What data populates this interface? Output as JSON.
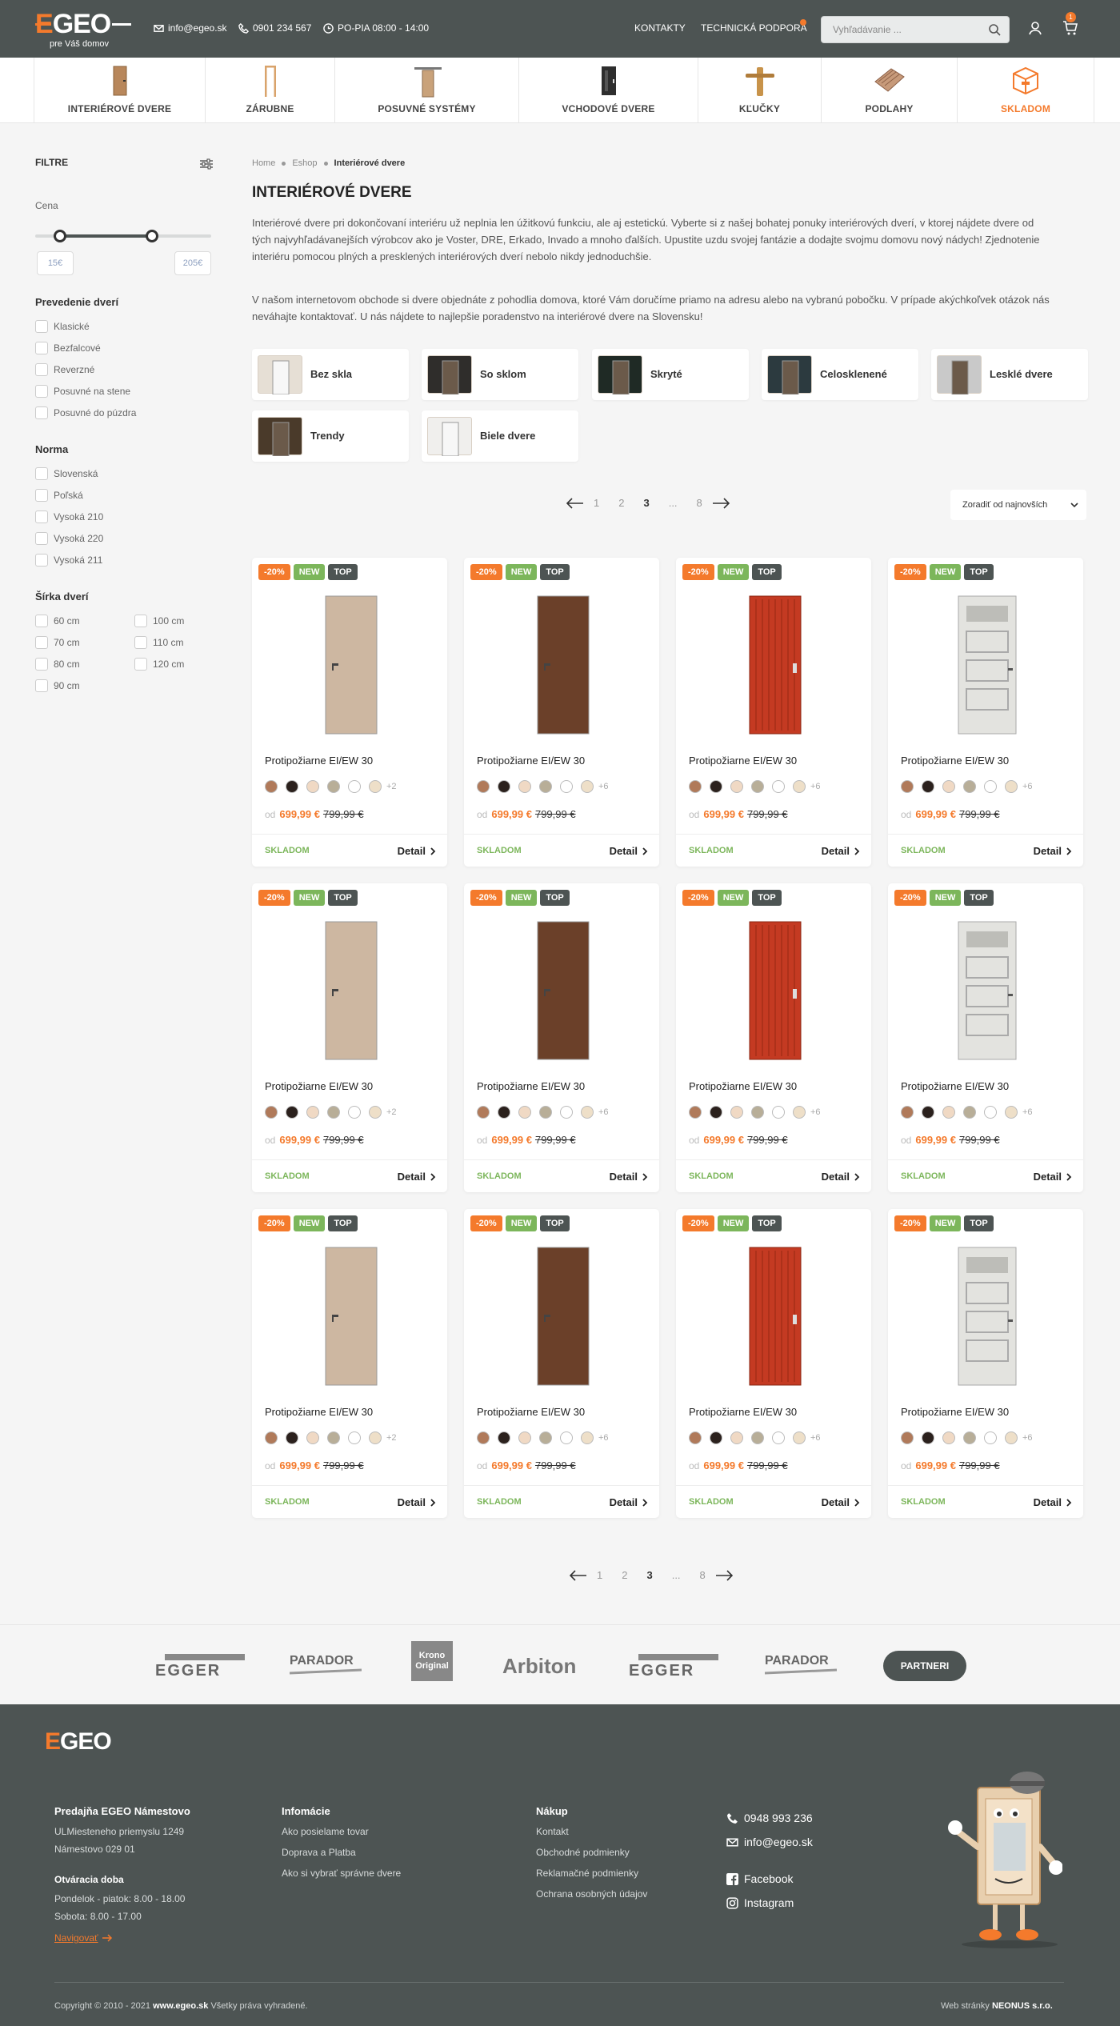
{
  "header": {
    "logo_text_accent": "E",
    "logo_text": "GEO",
    "logo_sub": "pre Váš domov",
    "email": "info@egeo.sk",
    "phone": "0901 234 567",
    "hours": "PO-PIA 08:00 - 14:00",
    "links": [
      "KONTAKTY",
      "TECHNICKÁ PODPORA"
    ],
    "search_placeholder": "Vyhľadávanie ...",
    "cart_count": "1"
  },
  "categories": [
    {
      "label": "INTERIÉROVÉ DVERE",
      "icon": "interior-door-icon"
    },
    {
      "label": "ZÁRUBNE",
      "icon": "door-frame-icon"
    },
    {
      "label": "POSUVNÉ SYSTÉMY",
      "icon": "sliding-door-icon"
    },
    {
      "label": "VCHODOVÉ DVERE",
      "icon": "entrance-door-icon"
    },
    {
      "label": "KĽUČKY",
      "icon": "door-handle-icon"
    },
    {
      "label": "PODLAHY",
      "icon": "flooring-icon"
    },
    {
      "label": "SKLADOM",
      "icon": "box-icon"
    }
  ],
  "sidebar": {
    "title": "FILTRE",
    "price_label": "Cena",
    "price_min": "15€",
    "price_max": "205€",
    "price_range_fraction": [
      0.14,
      0.66
    ],
    "groups": [
      {
        "title": "Prevedenie dverí",
        "items": [
          "Klasické",
          "Bezfalcové",
          "Reverzné",
          "Posuvné na stene",
          "Posuvné do púzdra"
        ]
      },
      {
        "title": "Norma",
        "items": [
          "Slovenská",
          "Poľská",
          "Vysoká 210",
          "Vysoká 220",
          "Vysoká 211"
        ]
      },
      {
        "title": "Šírka dverí",
        "items": [
          "60 cm",
          "100 cm",
          "70 cm",
          "110 cm",
          "80 cm",
          "120 cm",
          "90 cm"
        ]
      }
    ]
  },
  "breadcrumb": [
    "Home",
    "Eshop",
    "Interiérové dvere"
  ],
  "page_title": "INTERIÉROVÉ DVERE",
  "description": [
    "Interiérové dvere pri dokončovaní interiéru už neplnia len úžitkovú funkciu, ale aj estetickú. Vyberte si z našej bohatej ponuky interiérových dverí, v ktorej nájdete dvere od tých najvyhľadávanejších výrobcov ako je Voster, DRE, Erkado, Invado a mnoho ďalších. Upustite uzdu svojej fantázie a dodajte svojmu domovu nový nádych! Zjednotenie interiéru pomocou plných a presklených interiérových dverí nebolo nikdy jednoduchšie.",
    "V našom internetovom obchode si dvere objednáte z pohodlia domova, ktoré Vám doručíme priamo na adresu alebo na vybranú pobočku. V prípade akýchkoľvek otázok nás neváhajte kontaktovať. U nás nájdete to najlepšie poradenstvo na interiérové dvere na Slovensku!"
  ],
  "subcategories": [
    "Bez skla",
    "So sklom",
    "Skryté",
    "Celosklenené",
    "Lesklé dvere",
    "Trendy",
    "Biele dvere"
  ],
  "pagination": {
    "pages": [
      "1",
      "2",
      "3",
      "...",
      "8"
    ],
    "current": "3"
  },
  "sort": "Zoradiť od najnovších",
  "product": {
    "tags": [
      "-20%",
      "NEW",
      "TOP"
    ],
    "name": "Protipožiarne EI/EW 30",
    "price_prefix": "od",
    "price": "699,99 €",
    "old_price": "799,99 €",
    "stock": "SKLADOM",
    "detail": "Detail",
    "more_colors": [
      "+2",
      "+6",
      "+6",
      "+6"
    ]
  },
  "colors": {
    "accent": "#f47a2c",
    "dark": "#4d5453",
    "green": "#7cb65b",
    "swatches": [
      "#b07a5a",
      "#2b211d",
      "#f0d9c4",
      "#b8ae98",
      "#ffffff",
      "#eedfc8"
    ]
  },
  "partners": [
    "EGGER",
    "PARADOR",
    "Krono Original",
    "Arbiton",
    "EGGER",
    "PARADOR"
  ],
  "partners_button": "PARTNERI",
  "footer": {
    "col1_title": "Predajňa EGEO Námestovo",
    "address": [
      "ULMiesteneho priemyslu 1249",
      "Námestovo 029 01"
    ],
    "hours_title": "Otváracia doba",
    "hours": [
      "Pondelok - piatok: 8.00 - 18.00",
      "Sobota: 8.00 - 17.00"
    ],
    "navigate": "Navigovať",
    "col2_title": "Infomácie",
    "col2_items": [
      "Ako posielame tovar",
      "Doprava a Platba",
      "Ako si vybrať správne dvere"
    ],
    "col3_title": "Nákup",
    "col3_items": [
      "Kontakt",
      "Obchodné podmienky",
      "Reklamačné podmienky",
      "Ochrana osobných údajov"
    ],
    "phone": "0948 993 236",
    "email": "info@egeo.sk",
    "facebook": "Facebook",
    "instagram": "Instagram",
    "copyright_pre": "Copyright © 2010 - 2021",
    "copyright_site": "www.egeo.sk",
    "copyright_post": "Všetky práva vyhradené.",
    "credit_pre": "Web stránky",
    "credit": "NEONUS s.r.o."
  }
}
